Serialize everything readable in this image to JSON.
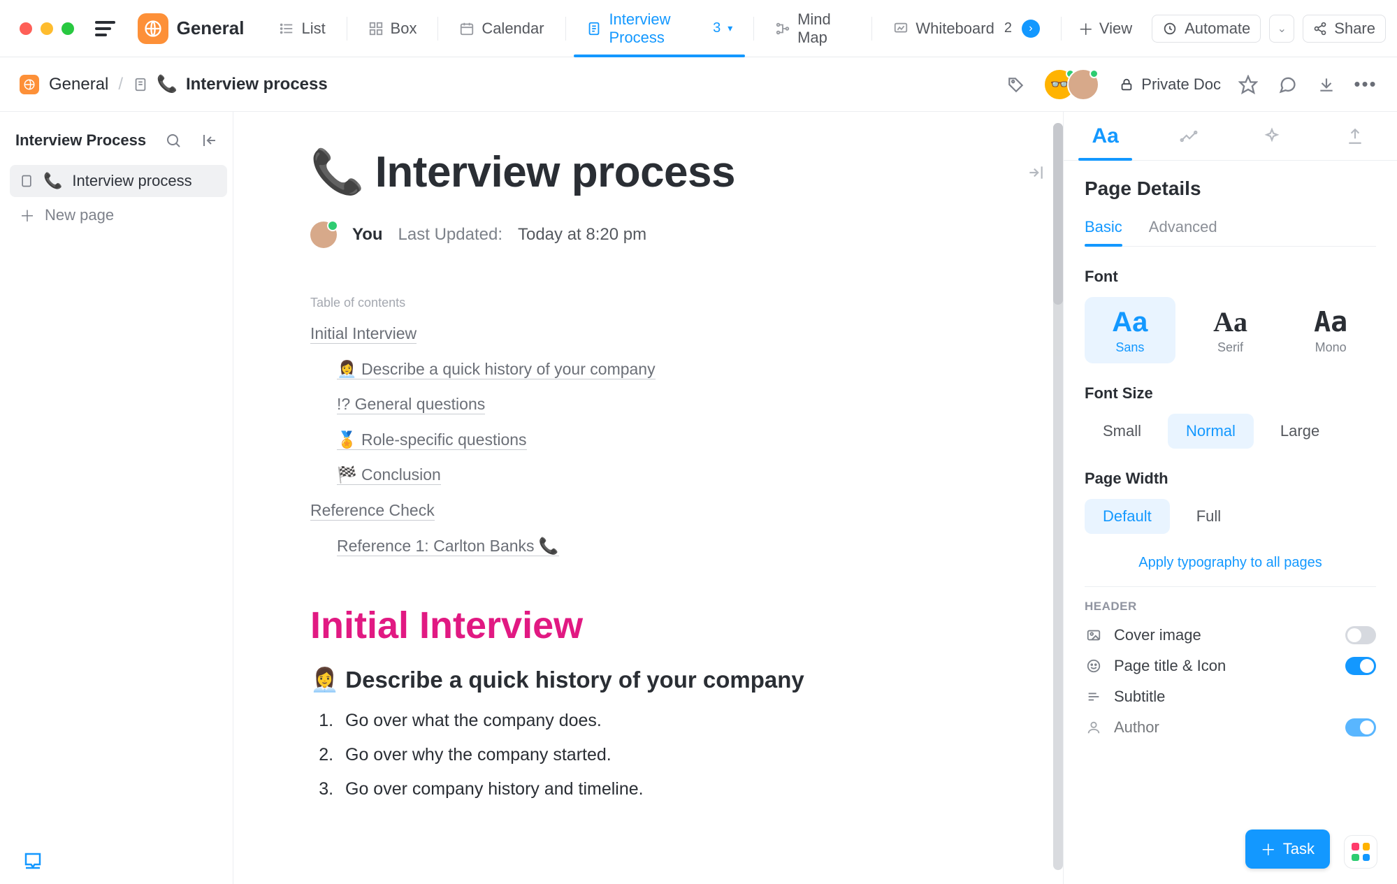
{
  "topbar": {
    "space_name": "General",
    "views": [
      {
        "label": "List"
      },
      {
        "label": "Box"
      },
      {
        "label": "Calendar"
      },
      {
        "label": "Interview Process",
        "badge": "3",
        "active": true
      },
      {
        "label": "Mind Map"
      },
      {
        "label": "Whiteboard",
        "badge": "2"
      }
    ],
    "view_btn": "View",
    "automate_btn": "Automate",
    "share_btn": "Share"
  },
  "crumb": {
    "space": "General",
    "page_emoji": "📞",
    "page": "Interview process",
    "privacy": "Private Doc"
  },
  "left": {
    "title": "Interview Process",
    "items": [
      {
        "emoji": "📞",
        "label": "Interview process",
        "active": true
      }
    ],
    "new_page": "New page"
  },
  "doc": {
    "title_emoji": "📞",
    "title": "Interview process",
    "author_you": "You",
    "last_updated_label": "Last Updated:",
    "last_updated_value": "Today at 8:20 pm",
    "toc_label": "Table of contents",
    "toc": [
      {
        "level": 1,
        "text": "Initial Interview"
      },
      {
        "level": 2,
        "text": "👩‍💼 Describe a quick history of your company"
      },
      {
        "level": 2,
        "text": "!? General questions"
      },
      {
        "level": 2,
        "text": "🏅 Role-specific questions"
      },
      {
        "level": 2,
        "text": "🏁 Conclusion"
      },
      {
        "level": 1,
        "text": "Reference Check"
      },
      {
        "level": 2,
        "text": "Reference 1: Carlton Banks 📞"
      }
    ],
    "h1": "Initial Interview",
    "h2": "👩‍💼 Describe a quick history of your company",
    "steps": [
      "Go over what the company does.",
      "Go over why the company started.",
      "Go over company history and timeline."
    ]
  },
  "right": {
    "title": "Page Details",
    "sub_tabs": {
      "basic": "Basic",
      "advanced": "Advanced"
    },
    "font_label": "Font",
    "fonts": {
      "sans": "Sans",
      "serif": "Serif",
      "mono": "Mono",
      "sample": "Aa"
    },
    "font_size_label": "Font Size",
    "font_sizes": {
      "small": "Small",
      "normal": "Normal",
      "large": "Large"
    },
    "page_width_label": "Page Width",
    "page_widths": {
      "default": "Default",
      "full": "Full"
    },
    "apply_link": "Apply typography to all pages",
    "header_section": "HEADER",
    "header_rows": {
      "cover": "Cover image",
      "title_icon": "Page title & Icon",
      "subtitle": "Subtitle",
      "author": "Author"
    }
  },
  "fab": {
    "task": "Task"
  }
}
